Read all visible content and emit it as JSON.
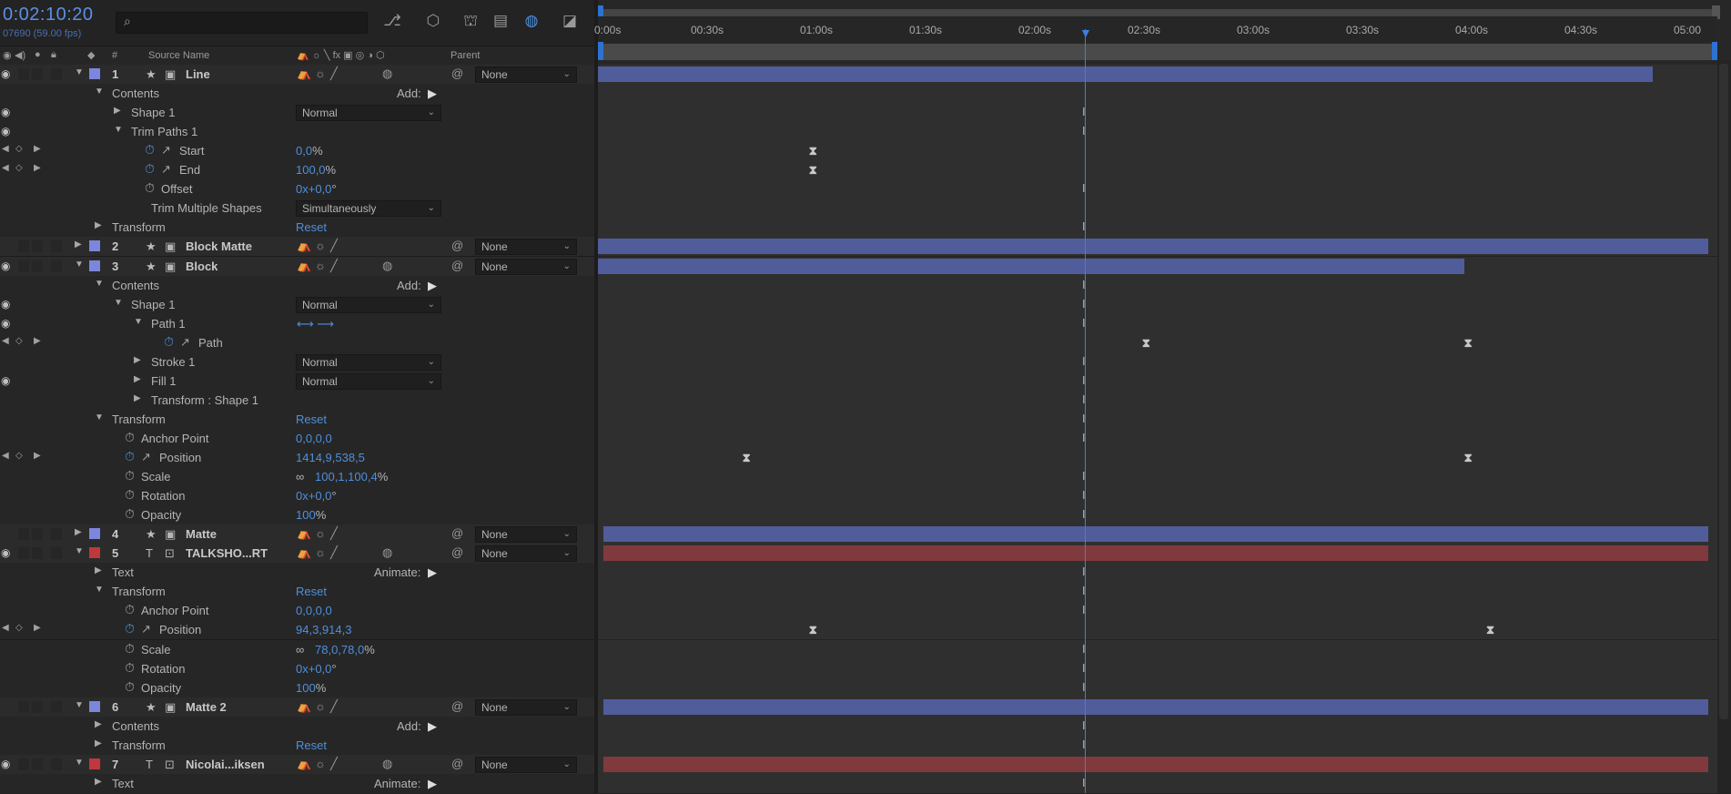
{
  "comp": {
    "timecode": "0:02:10:20",
    "frames": "07690 (59.00 fps)"
  },
  "header": {
    "hash": "#",
    "source_name": "Source Name",
    "parent": "Parent"
  },
  "add_label": "Add:",
  "animate_label": "Animate:",
  "reset_label": "Reset",
  "ruler": [
    "0:00s",
    "00:30s",
    "01:00s",
    "01:30s",
    "02:00s",
    "02:30s",
    "03:00s",
    "03:30s",
    "04:00s",
    "04:30s",
    "05:00"
  ],
  "rows": [
    {
      "kind": "layer",
      "num": "1",
      "type": "star",
      "name": "Line",
      "color": "#7b86dc",
      "expanded": true,
      "parent": "None",
      "eye": true,
      "bar": {
        "from": 0,
        "to": 0.95,
        "color": "blue"
      }
    },
    {
      "kind": "prop",
      "indent": 1,
      "label": "Contents",
      "add": true,
      "tri": "down",
      "eye": false
    },
    {
      "kind": "prop",
      "indent": 2,
      "label": "Shape 1",
      "tri": "right",
      "eye": true,
      "dropdown": "Normal",
      "ibar": true
    },
    {
      "kind": "prop",
      "indent": 2,
      "label": "Trim Paths 1",
      "tri": "down",
      "eye": true,
      "ibar": true
    },
    {
      "kind": "prop",
      "indent": 3,
      "label": "Start",
      "stopwatch": "on",
      "graph": true,
      "value": "0,0",
      "unit": "%",
      "kfnav": true,
      "kfs": [
        0.19
      ]
    },
    {
      "kind": "prop",
      "indent": 3,
      "label": "End",
      "stopwatch": "on",
      "graph": true,
      "value": "100,0",
      "unit": "%",
      "kfnav": true,
      "kfs": [
        0.19
      ]
    },
    {
      "kind": "prop",
      "indent": 3,
      "label": "Offset",
      "stopwatch": "off",
      "value": "0x+0,0",
      "unit": "°",
      "ibar": true
    },
    {
      "kind": "prop",
      "indent": 3,
      "label": "Trim Multiple Shapes",
      "dropdown": "Simultaneously",
      "ibar": false
    },
    {
      "kind": "prop",
      "indent": 1,
      "label": "Transform",
      "tri": "right",
      "reset": true,
      "ibar": true
    },
    {
      "kind": "layer",
      "num": "2",
      "type": "star",
      "name": "Block Matte",
      "color": "#7b86dc",
      "expanded": false,
      "parent": "None",
      "eye": false,
      "bar": {
        "from": 0,
        "to": 1,
        "color": "blue"
      }
    },
    {
      "kind": "layer",
      "num": "3",
      "type": "star",
      "name": "Block",
      "color": "#7b86dc",
      "expanded": true,
      "parent": "None",
      "eye": true,
      "bar": {
        "from": 0,
        "to": 0.78,
        "color": "blue"
      }
    },
    {
      "kind": "prop",
      "indent": 1,
      "label": "Contents",
      "add": true,
      "tri": "down",
      "ibar": true
    },
    {
      "kind": "prop",
      "indent": 2,
      "label": "Shape 1",
      "tri": "down",
      "eye": true,
      "dropdown": "Normal",
      "ibar": true
    },
    {
      "kind": "prop",
      "indent": 3,
      "label": "Path 1",
      "tri": "down",
      "eye": true,
      "pathicons": true,
      "ibar": true
    },
    {
      "kind": "prop",
      "indent": 4,
      "label": "Path",
      "stopwatch": "on",
      "graph": true,
      "kfnav": true,
      "kfs": [
        0.49,
        0.78
      ]
    },
    {
      "kind": "prop",
      "indent": 3,
      "label": "Stroke 1",
      "tri": "right",
      "eye": false,
      "dropdown": "Normal",
      "ibar": true
    },
    {
      "kind": "prop",
      "indent": 3,
      "label": "Fill 1",
      "tri": "right",
      "eye": true,
      "dropdown": "Normal",
      "ibar": true
    },
    {
      "kind": "prop",
      "indent": 3,
      "label": "Transform : Shape 1",
      "tri": "right",
      "ibar": true
    },
    {
      "kind": "prop",
      "indent": 1,
      "label": "Transform",
      "tri": "down",
      "reset": true,
      "ibar": true
    },
    {
      "kind": "prop",
      "indent": 2,
      "label": "Anchor Point",
      "stopwatch": "off",
      "value": "0,0,0,0",
      "ibar": true
    },
    {
      "kind": "prop",
      "indent": 2,
      "label": "Position",
      "stopwatch": "on",
      "graph": true,
      "value": "1414,9,538,5",
      "kfnav": true,
      "kfs": [
        0.13,
        0.78
      ]
    },
    {
      "kind": "prop",
      "indent": 2,
      "label": "Scale",
      "stopwatch": "off",
      "link": true,
      "value": "100,1,100,4",
      "unit": "%",
      "ibar": true
    },
    {
      "kind": "prop",
      "indent": 2,
      "label": "Rotation",
      "stopwatch": "off",
      "value": "0x+0,0",
      "unit": "°",
      "ibar": true
    },
    {
      "kind": "prop",
      "indent": 2,
      "label": "Opacity",
      "stopwatch": "off",
      "value": "100",
      "unit": "%",
      "ibar": true
    },
    {
      "kind": "layer",
      "num": "4",
      "type": "star",
      "name": "Matte",
      "color": "#7b86dc",
      "expanded": false,
      "parent": "None",
      "eye": false,
      "bar": {
        "from": 0.005,
        "to": 1,
        "color": "blue"
      }
    },
    {
      "kind": "layer",
      "num": "5",
      "type": "T",
      "name": "TALKSHO...RT",
      "color": "#c0373c",
      "expanded": true,
      "parent": "None",
      "eye": true,
      "bar": {
        "from": 0.005,
        "to": 1,
        "color": "red"
      }
    },
    {
      "kind": "prop",
      "indent": 1,
      "label": "Text",
      "tri": "right",
      "animate": true,
      "ibar": true
    },
    {
      "kind": "prop",
      "indent": 1,
      "label": "Transform",
      "tri": "down",
      "reset": true,
      "ibar": true
    },
    {
      "kind": "prop",
      "indent": 2,
      "label": "Anchor Point",
      "stopwatch": "off",
      "value": "0,0,0,0",
      "ibar": true
    },
    {
      "kind": "prop",
      "indent": 2,
      "label": "Position",
      "stopwatch": "on",
      "graph": true,
      "value": "94,3,914,3",
      "kfnav": true,
      "kfs": [
        0.19,
        0.8
      ]
    },
    {
      "kind": "prop",
      "indent": 2,
      "label": "Scale",
      "stopwatch": "off",
      "link": true,
      "value": "78,0,78,0",
      "unit": "%",
      "ibar": true
    },
    {
      "kind": "prop",
      "indent": 2,
      "label": "Rotation",
      "stopwatch": "off",
      "value": "0x+0,0",
      "unit": "°",
      "ibar": true
    },
    {
      "kind": "prop",
      "indent": 2,
      "label": "Opacity",
      "stopwatch": "off",
      "value": "100",
      "unit": "%",
      "ibar": true
    },
    {
      "kind": "layer",
      "num": "6",
      "type": "star",
      "name": "Matte 2",
      "color": "#7b86dc",
      "expanded": true,
      "parent": "None",
      "eye": false,
      "bar": {
        "from": 0.005,
        "to": 1,
        "color": "blue"
      }
    },
    {
      "kind": "prop",
      "indent": 1,
      "label": "Contents",
      "tri": "right",
      "add": true,
      "ibar": true
    },
    {
      "kind": "prop",
      "indent": 1,
      "label": "Transform",
      "tri": "right",
      "reset": true,
      "ibar": true
    },
    {
      "kind": "layer",
      "num": "7",
      "type": "T",
      "name": "Nicolai...iksen",
      "color": "#c0373c",
      "expanded": true,
      "parent": "None",
      "eye": true,
      "bar": {
        "from": 0.005,
        "to": 1,
        "color": "red"
      }
    },
    {
      "kind": "prop",
      "indent": 1,
      "label": "Text",
      "tri": "right",
      "animate": true,
      "ibar": true
    }
  ]
}
